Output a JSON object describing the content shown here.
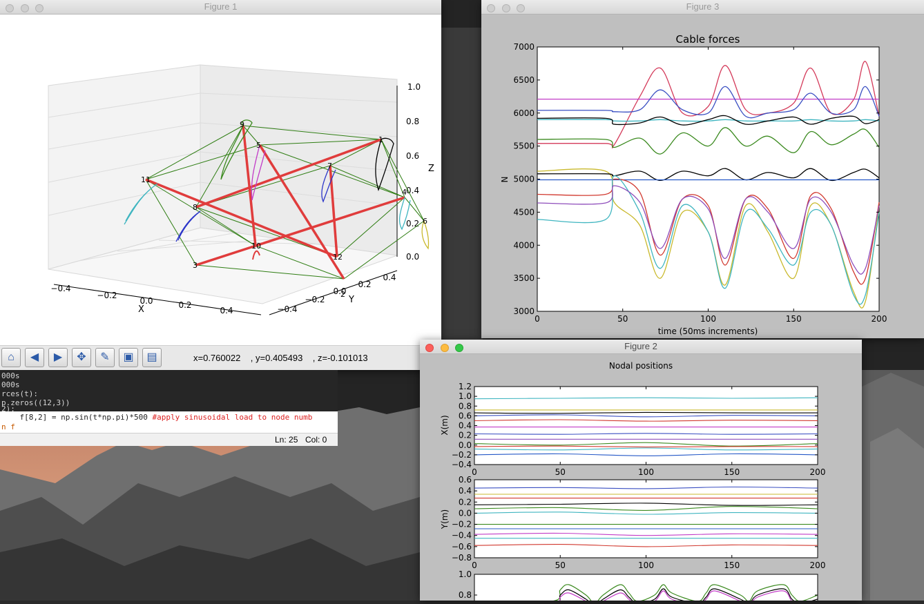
{
  "desktop": {
    "wallpaper": "yosemite-cliffs"
  },
  "figure1": {
    "title": "Figure 1",
    "axis_labels": {
      "x": "X",
      "y": "Y",
      "z": "Z"
    },
    "x_ticks": [
      "−0.4",
      "−0.2",
      "0.0",
      "0.2",
      "0.4"
    ],
    "y_ticks": [
      "−0.4",
      "−0.2",
      "0.0",
      "0.2",
      "0.4"
    ],
    "z_ticks": [
      "0.0",
      "0.2",
      "0.4",
      "0.6",
      "0.8",
      "1.0"
    ],
    "node_labels": [
      "2",
      "3",
      "4",
      "6",
      "8",
      "9",
      "10",
      "11",
      "12"
    ],
    "node_labels_b": [
      "5",
      "7",
      "1"
    ],
    "toolbar": {
      "buttons": [
        "home-icon",
        "back-icon",
        "forward-icon",
        "pan-icon",
        "configure-subplots-icon",
        "zoom-icon",
        "save-icon"
      ],
      "coord_x": "x=0.760022",
      "coord_y": ", y=0.405493",
      "coord_z": ", z=-0.101013"
    }
  },
  "figure3": {
    "title": "Figure 3",
    "chart_data": {
      "type": "line",
      "title": "Cable forces",
      "xlabel": "time (50ms increments)",
      "ylabel": "N",
      "xlim": [
        0,
        200
      ],
      "ylim": [
        3000,
        7000
      ],
      "xticks": [
        "0",
        "50",
        "100",
        "150",
        "200"
      ],
      "yticks": [
        "3000",
        "3500",
        "4000",
        "4500",
        "5000",
        "5500",
        "6000",
        "6500",
        "7000"
      ],
      "x": [
        0,
        40,
        45,
        60,
        72,
        85,
        100,
        110,
        122,
        135,
        150,
        160,
        172,
        185,
        192,
        200
      ],
      "series": [
        {
          "color": "#d43a5a",
          "values": [
            5540,
            5540,
            5520,
            6250,
            6680,
            6000,
            6100,
            6720,
            6050,
            6000,
            6150,
            6680,
            6000,
            6200,
            6780,
            5950
          ]
        },
        {
          "color": "#c23bc7",
          "values": [
            6210,
            6210,
            6210,
            6210,
            6210,
            6210,
            6210,
            6210,
            6210,
            6210,
            6210,
            6210,
            6210,
            6210,
            6210,
            6210
          ]
        },
        {
          "color": "#3a4fc2",
          "values": [
            6040,
            6040,
            6020,
            6050,
            6350,
            6050,
            6000,
            6400,
            5950,
            6000,
            6050,
            6300,
            6000,
            6050,
            6400,
            5950
          ]
        },
        {
          "color": "#3fb5c0",
          "values": [
            5900,
            5900,
            5880,
            5880,
            5900,
            5880,
            5880,
            5900,
            5880,
            5880,
            5880,
            5900,
            5880,
            5880,
            5900,
            5880
          ]
        },
        {
          "color": "#000000",
          "values": [
            5920,
            5920,
            5830,
            5850,
            5940,
            5820,
            5900,
            5960,
            5830,
            5880,
            5940,
            5830,
            5920,
            5950,
            5840,
            5900
          ]
        },
        {
          "color": "#3b8a1f",
          "values": [
            5600,
            5600,
            5480,
            5620,
            5380,
            5700,
            5500,
            5780,
            5500,
            5650,
            5400,
            5720,
            5520,
            5680,
            5750,
            5480
          ]
        },
        {
          "color": "#c9b92c",
          "values": [
            5120,
            5120,
            4650,
            4300,
            3500,
            4500,
            4200,
            3400,
            4600,
            4200,
            3500,
            4600,
            4300,
            3300,
            3150,
            4600
          ]
        },
        {
          "color": "#000000",
          "values": [
            5080,
            5080,
            5050,
            5120,
            4980,
            5120,
            5050,
            5160,
            4990,
            5100,
            5020,
            5160,
            4980,
            5100,
            5150,
            5020
          ]
        },
        {
          "color": "#2458c7",
          "values": [
            4990,
            4990,
            4990,
            4990,
            4990,
            4990,
            4990,
            4990,
            4990,
            4990,
            4990,
            4990,
            4990,
            4990,
            4990,
            4990
          ]
        },
        {
          "color": "#d1382e",
          "values": [
            4770,
            4770,
            5000,
            4800,
            3850,
            4700,
            4600,
            3700,
            4700,
            4550,
            3800,
            4750,
            4550,
            3600,
            3500,
            4650
          ]
        },
        {
          "color": "#3fb5c0",
          "values": [
            4390,
            4390,
            5050,
            4500,
            3650,
            4600,
            4200,
            3350,
            4500,
            4250,
            3700,
            4500,
            4300,
            3250,
            3250,
            4500
          ]
        },
        {
          "color": "#8e4dbb",
          "values": [
            4640,
            4640,
            4900,
            4650,
            3950,
            4700,
            4550,
            3800,
            4700,
            4500,
            3950,
            4700,
            4500,
            3700,
            3650,
            4600
          ]
        }
      ]
    }
  },
  "figure2": {
    "title": "Figure 2",
    "chart_data": [
      {
        "type": "line",
        "title": "Nodal positions",
        "ylabel": "X(m)",
        "xlim": [
          0,
          200
        ],
        "ylim": [
          -0.4,
          1.2
        ],
        "xticks": [
          "0",
          "50",
          "100",
          "150",
          "200"
        ],
        "yticks": [
          "−0.4",
          "−0.2",
          "0.0",
          "0.2",
          "0.4",
          "0.6",
          "0.8",
          "1.0",
          "1.2"
        ],
        "x": [
          0,
          50,
          100,
          150,
          200
        ],
        "series": [
          {
            "color": "#3fb5c0",
            "values": [
              0.95,
              0.96,
              0.97,
              0.96,
              0.97
            ]
          },
          {
            "color": "#c9b92c",
            "values": [
              0.72,
              0.72,
              0.72,
              0.72,
              0.72
            ]
          },
          {
            "color": "#000000",
            "values": [
              0.66,
              0.65,
              0.67,
              0.66,
              0.66
            ]
          },
          {
            "color": "#3a4fc2",
            "values": [
              0.6,
              0.62,
              0.58,
              0.61,
              0.6
            ]
          },
          {
            "color": "#d1382e",
            "values": [
              0.5,
              0.52,
              0.49,
              0.51,
              0.5
            ]
          },
          {
            "color": "#c23bc7",
            "values": [
              0.37,
              0.37,
              0.37,
              0.37,
              0.37
            ]
          },
          {
            "color": "#3a4fc2",
            "values": [
              0.23,
              0.22,
              0.24,
              0.22,
              0.23
            ]
          },
          {
            "color": "#8e4dbb",
            "values": [
              0.12,
              0.12,
              0.12,
              0.12,
              0.12
            ]
          },
          {
            "color": "#3b8a1f",
            "values": [
              0.03,
              0.0,
              0.05,
              -0.02,
              0.03
            ]
          },
          {
            "color": "#d1382e",
            "values": [
              -0.03,
              -0.02,
              -0.04,
              -0.03,
              -0.03
            ]
          },
          {
            "color": "#3fb5c0",
            "values": [
              -0.08,
              -0.1,
              -0.06,
              -0.1,
              -0.08
            ]
          },
          {
            "color": "#2458c7",
            "values": [
              -0.2,
              -0.18,
              -0.22,
              -0.18,
              -0.2
            ]
          }
        ]
      },
      {
        "type": "line",
        "ylabel": "Y(m)",
        "xlim": [
          0,
          200
        ],
        "ylim": [
          -0.8,
          0.6
        ],
        "xticks": [
          "0",
          "50",
          "100",
          "150",
          "200"
        ],
        "yticks": [
          "−0.8",
          "−0.6",
          "−0.4",
          "−0.2",
          "0.0",
          "0.2",
          "0.4",
          "0.6"
        ],
        "x": [
          0,
          50,
          100,
          150,
          200
        ],
        "series": [
          {
            "color": "#3a4fc2",
            "values": [
              0.45,
              0.46,
              0.44,
              0.47,
              0.45
            ]
          },
          {
            "color": "#c9b92c",
            "values": [
              0.34,
              0.34,
              0.34,
              0.34,
              0.34
            ]
          },
          {
            "color": "#d1382e",
            "values": [
              0.27,
              0.27,
              0.27,
              0.27,
              0.27
            ]
          },
          {
            "color": "#000000",
            "values": [
              0.15,
              0.16,
              0.18,
              0.14,
              0.15
            ]
          },
          {
            "color": "#3b8a1f",
            "values": [
              0.08,
              0.1,
              0.05,
              0.12,
              0.08
            ]
          },
          {
            "color": "#3fb5c0",
            "values": [
              0.0,
              0.02,
              -0.02,
              0.01,
              0.0
            ]
          },
          {
            "color": "#3b8a1f",
            "values": [
              -0.2,
              -0.2,
              -0.2,
              -0.2,
              -0.2
            ]
          },
          {
            "color": "#2458c7",
            "values": [
              -0.28,
              -0.28,
              -0.28,
              -0.28,
              -0.28
            ]
          },
          {
            "color": "#c23bc7",
            "values": [
              -0.38,
              -0.36,
              -0.4,
              -0.37,
              -0.38
            ]
          },
          {
            "color": "#3fb5c0",
            "values": [
              -0.45,
              -0.45,
              -0.45,
              -0.45,
              -0.45
            ]
          },
          {
            "color": "#d1382e",
            "values": [
              -0.58,
              -0.56,
              -0.6,
              -0.57,
              -0.58
            ]
          }
        ]
      },
      {
        "type": "line",
        "xlim": [
          0,
          200
        ],
        "ylim": [
          0.6,
          1.0
        ],
        "yticks": [
          "0.8",
          "1.0"
        ],
        "x": [
          0,
          45,
          50,
          55,
          65,
          70,
          75,
          85,
          90,
          95,
          105,
          110,
          115,
          130,
          135,
          140,
          155,
          160,
          165,
          180,
          185,
          190,
          200
        ],
        "series": [
          {
            "color": "#3b8a1f",
            "values": [
              0.74,
              0.74,
              0.85,
              0.9,
              0.8,
              0.72,
              0.8,
              0.9,
              0.82,
              0.74,
              0.8,
              0.9,
              0.82,
              0.74,
              0.82,
              0.9,
              0.8,
              0.74,
              0.84,
              0.9,
              0.8,
              0.74,
              0.8
            ]
          },
          {
            "color": "#000000",
            "values": [
              0.72,
              0.72,
              0.8,
              0.85,
              0.76,
              0.7,
              0.76,
              0.85,
              0.78,
              0.72,
              0.76,
              0.86,
              0.78,
              0.72,
              0.78,
              0.86,
              0.76,
              0.72,
              0.8,
              0.86,
              0.76,
              0.72,
              0.76
            ]
          },
          {
            "color": "#c23bc7",
            "values": [
              0.7,
              0.7,
              0.78,
              0.82,
              0.74,
              0.69,
              0.74,
              0.82,
              0.76,
              0.7,
              0.74,
              0.84,
              0.76,
              0.7,
              0.76,
              0.84,
              0.74,
              0.7,
              0.78,
              0.84,
              0.74,
              0.7,
              0.74
            ]
          }
        ]
      }
    ]
  },
  "editor": {
    "lines": [
      "000s",
      "000s",
      "rces(t):",
      "p.zeros((12,3))",
      "2):",
      "    f[8,2] = np.sin(t*np.pi)*500 ",
      "n f"
    ],
    "comment": "#apply sinusoidal load to node numb",
    "status_ln": "Ln: 25",
    "status_col": "Col: 0"
  }
}
